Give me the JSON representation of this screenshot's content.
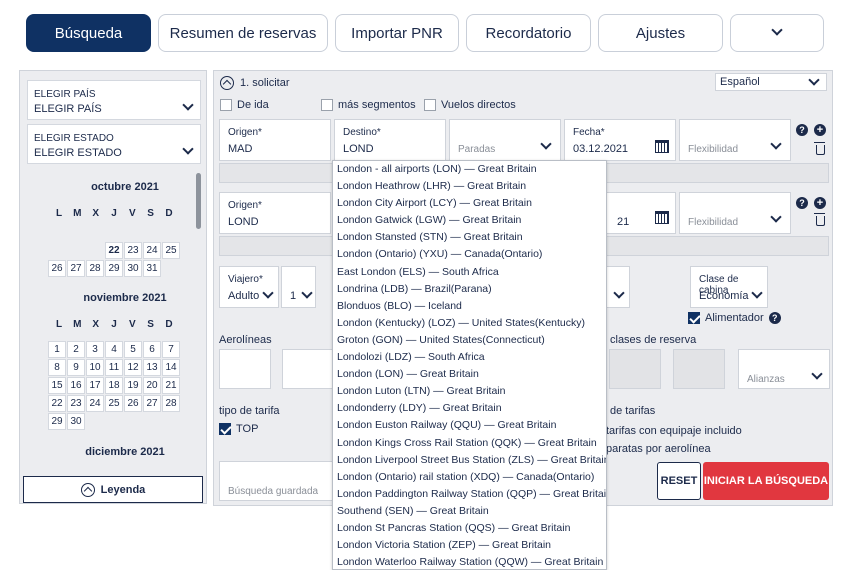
{
  "tabs": [
    {
      "label": "Búsqueda",
      "active": true
    },
    {
      "label": "Resumen de reservas"
    },
    {
      "label": "Importar PNR"
    },
    {
      "label": "Recordatorio"
    },
    {
      "label": "Ajustes"
    }
  ],
  "left": {
    "country": {
      "label": "ELEGIR PAÍS",
      "value": "ELEGIR PAÍS"
    },
    "state": {
      "label": "ELEGIR ESTADO",
      "value": "ELEGIR ESTADO"
    },
    "weekdays": [
      "L",
      "M",
      "X",
      "J",
      "V",
      "S",
      "D"
    ],
    "months": [
      {
        "name": "octubre 2021",
        "days": [
          "22",
          "23",
          "24",
          "25",
          "26",
          "27",
          "28",
          "29",
          "30",
          "31"
        ]
      },
      {
        "name": "noviembre 2021",
        "days": [
          "1",
          "2",
          "3",
          "4",
          "5",
          "6",
          "7",
          "8",
          "9",
          "10",
          "11",
          "12",
          "13",
          "14",
          "15",
          "16",
          "17",
          "18",
          "19",
          "20",
          "21",
          "22",
          "23",
          "24",
          "25",
          "26",
          "27",
          "28",
          "29",
          "30"
        ]
      },
      {
        "name": "diciembre 2021"
      }
    ],
    "legend_label": "Leyenda"
  },
  "main": {
    "step_label": "1. solicitar",
    "language": "Español",
    "options": {
      "one_way": "De ida",
      "more_segments": "más segmentos",
      "direct": "Vuelos directos"
    },
    "row1": {
      "origin_label": "Origen*",
      "origin_value": "MAD",
      "dest_label": "Destino*",
      "dest_value": "LOND",
      "stops_placeholder": "Paradas",
      "date_label": "Fecha*",
      "date_value": "03.12.2021",
      "flex_placeholder": "Flexibilidad"
    },
    "row2": {
      "origin_label": "Origen*",
      "origin_value": "LOND",
      "date_partial": "21",
      "flex_placeholder": "Flexibilidad"
    },
    "traveler": {
      "label": "Viajero*",
      "value": "Adulto",
      "count": "1"
    },
    "cabin": {
      "label": "Clase de cabina",
      "value": "Economía"
    },
    "feeder": "Alimentador",
    "airlines_label": "Aerolíneas",
    "booking_classes_label": "clases de reserva",
    "alliances_placeholder": "Alianzas",
    "fare_type_label": "tipo de tarifa",
    "top_label": "TOP",
    "fares_label": "de tarifas",
    "fares_baggage": "tarifas con equipaje incluido",
    "fares_airline": "paratas por aerolínea",
    "saved_search_placeholder": "Búsqueda guardada",
    "reset_label": "RESET",
    "search_label": "INICIAR LA BÚSQUEDA"
  },
  "dropdown": [
    "London - all airports (LON) — Great Britain",
    "London Heathrow (LHR) — Great Britain",
    "London City Airport (LCY) — Great Britain",
    "London Gatwick (LGW) — Great Britain",
    "London Stansted (STN) — Great Britain",
    "London (Ontario) (YXU) — Canada(Ontario)",
    "East London (ELS) — South Africa",
    "Londrina (LDB) — Brazil(Parana)",
    "Blonduos (BLO) — Iceland",
    "London (Kentucky) (LOZ) — United States(Kentucky)",
    "Groton (GON) — United States(Connecticut)",
    "Londolozi (LDZ) — South Africa",
    "London (LON) — Great Britain",
    "London Luton (LTN) — Great Britain",
    "Londonderry (LDY) — Great Britain",
    "London Euston Railway (QQU) — Great Britain",
    "London Kings Cross Rail Station (QQK) — Great Britain",
    "London Liverpool Street Bus Station (ZLS) — Great Britain",
    "London (Ontario) rail station (XDQ) — Canada(Ontario)",
    "London Paddington Railway Station (QQP) — Great Britain",
    "Southend (SEN) — Great Britain",
    "London St Pancras Station (QQS) — Great Britain",
    "London Victoria Station (ZEP) — Great Britain",
    "London Waterloo Railway Station (QQW) — Great Britain"
  ]
}
